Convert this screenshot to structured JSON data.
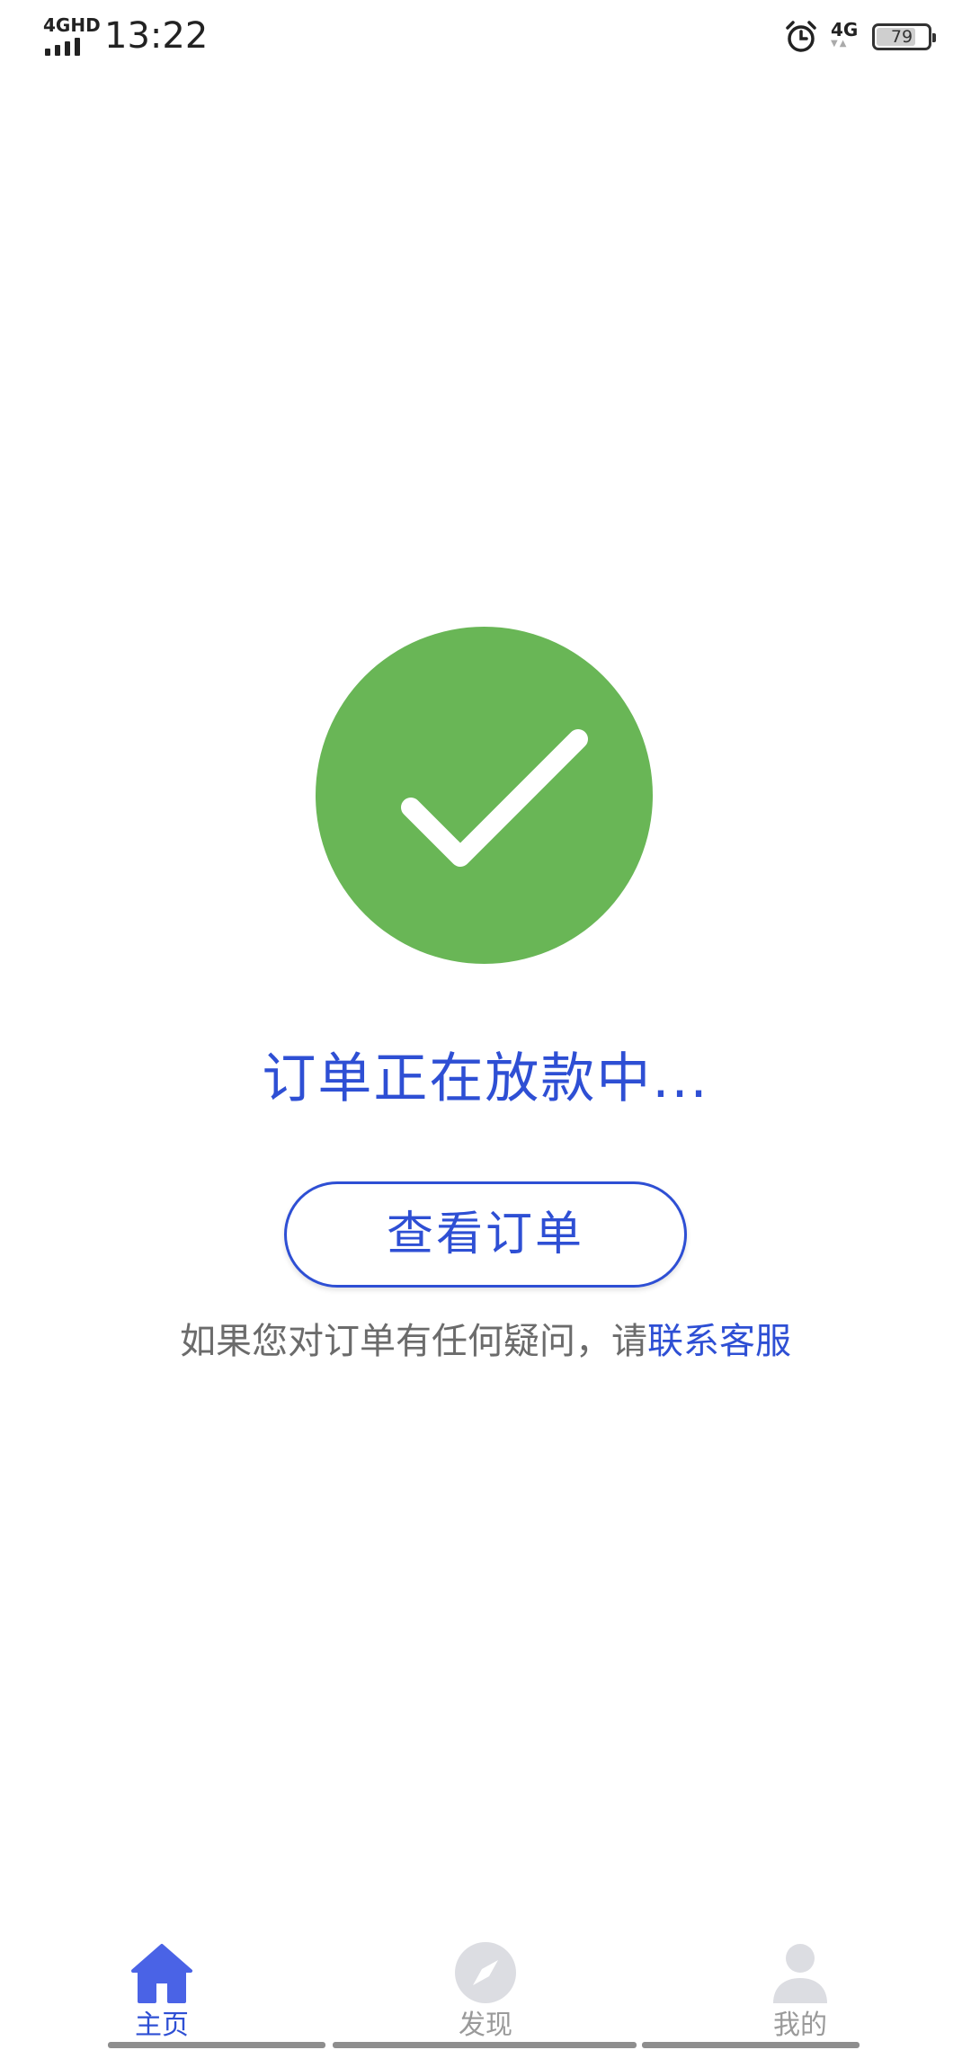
{
  "status_bar": {
    "network_type": "4GHD",
    "time": "13:22",
    "right_network": "4G",
    "battery_level": "79",
    "battery_fraction": 0.79,
    "icons": [
      "signal-icon",
      "alarm-icon",
      "mobile-data-icon",
      "battery-icon"
    ]
  },
  "main": {
    "status_icon": "check-circle-icon",
    "status_color": "#69b656",
    "title": "订单正在放款中...",
    "view_order_label": "查看订单",
    "help_text": "如果您对订单有任何疑问，请",
    "help_link": "联系客服"
  },
  "colors": {
    "accent": "#2e4fd4",
    "inactive": "#9a9a9a"
  },
  "bottom_nav": {
    "items": [
      {
        "label": "主页",
        "icon": "home-icon",
        "active": true
      },
      {
        "label": "发现",
        "icon": "compass-icon",
        "active": false
      },
      {
        "label": "我的",
        "icon": "user-icon",
        "active": false
      }
    ]
  }
}
